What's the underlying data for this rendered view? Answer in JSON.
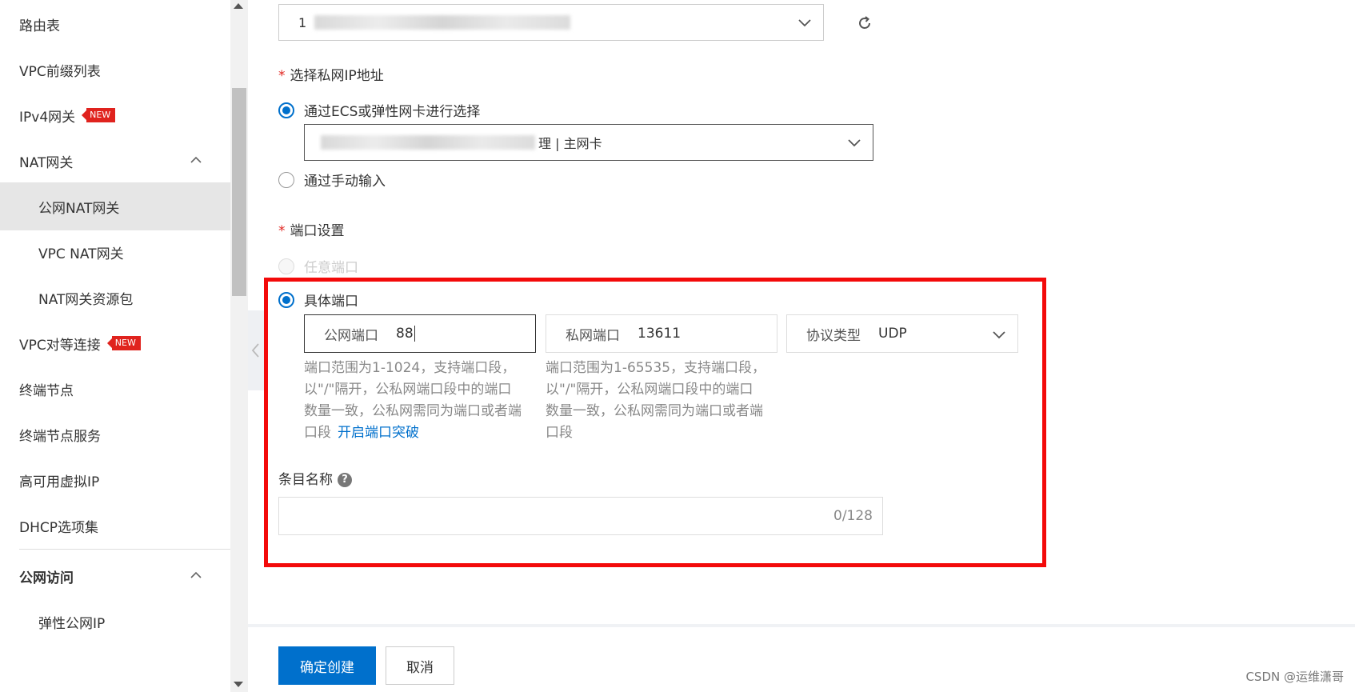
{
  "sidebar": {
    "items": [
      {
        "label": "路由表"
      },
      {
        "label": "VPC前缀列表"
      },
      {
        "label": "IPv4网关",
        "badge": "NEW"
      },
      {
        "label": "NAT网关"
      },
      {
        "label": "公网NAT网关"
      },
      {
        "label": "VPC NAT网关"
      },
      {
        "label": "NAT网关资源包"
      },
      {
        "label": "VPC对等连接",
        "badge": "NEW"
      },
      {
        "label": "终端节点"
      },
      {
        "label": "终端节点服务"
      },
      {
        "label": "高可用虚拟IP"
      },
      {
        "label": "DHCP选项集"
      },
      {
        "label": "公网访问"
      },
      {
        "label": "弹性公网IP"
      }
    ]
  },
  "form": {
    "top_select_value": "1",
    "private_ip_label": "选择私网IP地址",
    "radio_ecs": "通过ECS或弹性网卡进行选择",
    "eni_select_value": "理 | 主网卡",
    "radio_manual": "通过手动输入",
    "port_label": "端口设置",
    "radio_any_port": "任意端口",
    "radio_specific_port": "具体端口",
    "public_port_prefix": "公网端口",
    "public_port_value": "88",
    "private_port_prefix": "私网端口",
    "private_port_value": "13611",
    "protocol_prefix": "协议类型",
    "protocol_value": "UDP",
    "public_help": [
      "端口范围为1-1024，支持端口段，",
      "以\"/\"隔开，公私网端口段中的端口",
      "数量一致，公私网需同为端口或者端",
      "口段"
    ],
    "public_help_link": "开启端口突破",
    "private_help": [
      "端口范围为1-65535，支持端口段，",
      "以\"/\"隔开，公私网端口段中的端口",
      "数量一致，公私网需同为端口或者端",
      "口段"
    ],
    "entry_name_label": "条目名称",
    "entry_name_help": "?",
    "entry_name_counter": "0/128"
  },
  "footer": {
    "confirm": "确定创建",
    "cancel": "取消"
  },
  "watermark": "CSDN @运维潇哥",
  "colors": {
    "accent": "#0070cc",
    "badge": "#e0231e",
    "highlight": "#f30a0a"
  }
}
